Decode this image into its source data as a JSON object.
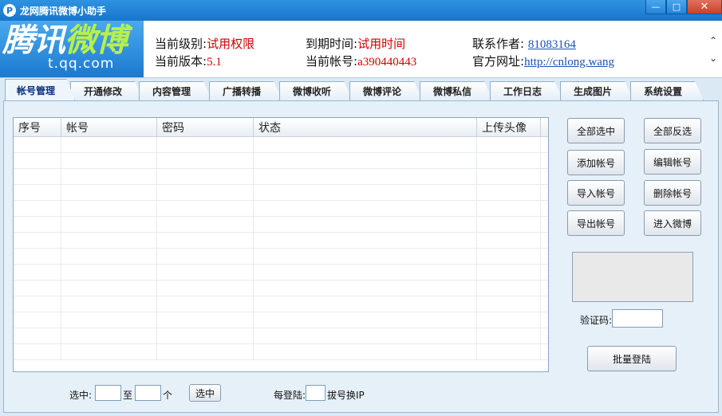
{
  "window": {
    "title": "龙网腾讯微博小助手",
    "icon_letter": "P"
  },
  "logo": {
    "main_left": "腾讯",
    "main_right": "微博",
    "sub": "t.qq.com"
  },
  "info": {
    "level_label": "当前级别:",
    "level_value": "试用权限",
    "version_label": "当前版本:",
    "version_value": "5.1",
    "expire_label": "到期时间:",
    "expire_value": "试用时间",
    "account_label": "当前帐号:",
    "account_value": "a390440443",
    "author_label": "联系作者:",
    "author_value": "81083164",
    "site_label": "官方网址:",
    "site_value": "http://cnlong.wang"
  },
  "tabs": [
    "帐号管理",
    "开通修改",
    "内容管理",
    "广播转播",
    "微博收听",
    "微博评论",
    "微博私信",
    "工作日志",
    "生成图片",
    "系统设置"
  ],
  "grid": {
    "columns": [
      "序号",
      "帐号",
      "密码",
      "状态",
      "上传头像"
    ]
  },
  "buttons": {
    "select_all": "全部选中",
    "invert": "全部反选",
    "add": "添加帐号",
    "edit": "编辑帐号",
    "import": "导入帐号",
    "delete": "删除帐号",
    "export": "导出帐号",
    "enter": "进入微博",
    "batch_login": "批量登陆",
    "select": "选中"
  },
  "captcha": {
    "label": "验证码:"
  },
  "footer": {
    "select_label": "选中:",
    "to_label": "至",
    "unit_label": "个",
    "per_login_label": "每登陆:",
    "switch_ip_label": "拔号换IP"
  }
}
